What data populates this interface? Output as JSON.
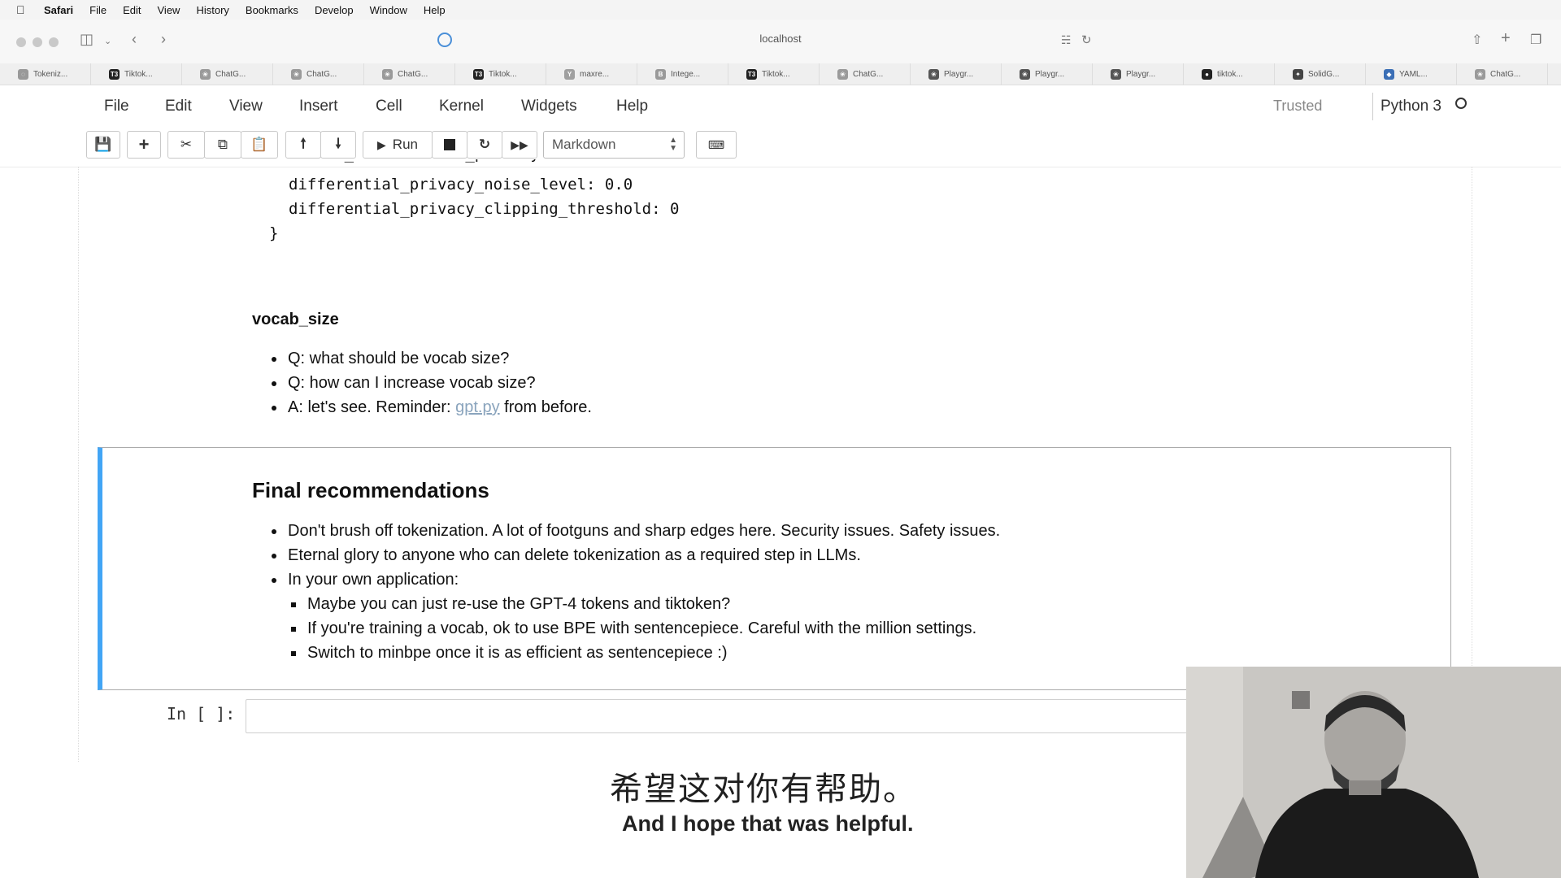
{
  "menubar": {
    "app": "Safari",
    "items": [
      "File",
      "Edit",
      "View",
      "History",
      "Bookmarks",
      "Develop",
      "Window",
      "Help"
    ]
  },
  "browser": {
    "address": "localhost",
    "tabs": [
      {
        "label": "Tokeniz...",
        "icon": "spinner-icon",
        "color": "#999999"
      },
      {
        "label": "Tiktok...",
        "icon": "t3-icon",
        "color": "#222222"
      },
      {
        "label": "ChatG...",
        "icon": "openai-icon",
        "color": "#9a9a9a"
      },
      {
        "label": "ChatG...",
        "icon": "openai-icon",
        "color": "#9a9a9a"
      },
      {
        "label": "ChatG...",
        "icon": "openai-icon",
        "color": "#9a9a9a"
      },
      {
        "label": "Tiktok...",
        "icon": "t3-icon",
        "color": "#222222"
      },
      {
        "label": "maxre...",
        "icon": "y-icon",
        "color": "#a0a0a0"
      },
      {
        "label": "Intege...",
        "icon": "b-icon",
        "color": "#9a9a9a"
      },
      {
        "label": "Tiktok...",
        "icon": "t3-icon",
        "color": "#222222"
      },
      {
        "label": "ChatG...",
        "icon": "openai-icon",
        "color": "#9a9a9a"
      },
      {
        "label": "Playgr...",
        "icon": "openai-icon",
        "color": "#555555"
      },
      {
        "label": "Playgr...",
        "icon": "openai-icon",
        "color": "#555555"
      },
      {
        "label": "Playgr...",
        "icon": "openai-icon",
        "color": "#555555"
      },
      {
        "label": "tiktok...",
        "icon": "github-icon",
        "color": "#222222"
      },
      {
        "label": "SolidG...",
        "icon": "sparkle-icon",
        "color": "#444444"
      },
      {
        "label": "YAML...",
        "icon": "cube-icon",
        "color": "#3b6fb6"
      },
      {
        "label": "ChatG...",
        "icon": "openai-icon",
        "color": "#9a9a9a"
      }
    ]
  },
  "jupyter": {
    "menu": [
      "File",
      "Edit",
      "View",
      "Insert",
      "Cell",
      "Kernel",
      "Widgets",
      "Help"
    ],
    "trusted": "Trusted",
    "kernel": "Python 3",
    "run_label": "Run",
    "cell_type": "Markdown"
  },
  "cells": {
    "code_tail": [
      "differential_privacy_noise_level: 0.0",
      "differential_privacy_clipping_threshold: 0",
      "}"
    ],
    "vocab": {
      "heading": "vocab_size",
      "items": [
        "Q: what should be vocab size?",
        "Q: how can I increase vocab size?"
      ],
      "a_prefix": "A: let's see. Reminder: ",
      "a_link": "gpt.py",
      "a_suffix": " from before."
    },
    "final": {
      "heading": "Final recommendations",
      "items": [
        "Don't brush off tokenization. A lot of footguns and sharp edges here. Security issues. Safety issues.",
        "Eternal glory to anyone who can delete tokenization as a required step in LLMs.",
        "In your own application:"
      ],
      "subitems": [
        "Maybe you can just re-use the GPT-4 tokens and tiktoken?",
        "If you're training a vocab, ok to use BPE with sentencepiece. Careful with the million settings.",
        "Switch to minbpe once it is as efficient as sentencepiece :)"
      ]
    },
    "input_prompt": "In [ ]:"
  },
  "subtitles": {
    "zh": "希望这对你有帮助。",
    "en": "And I hope that was helpful."
  }
}
